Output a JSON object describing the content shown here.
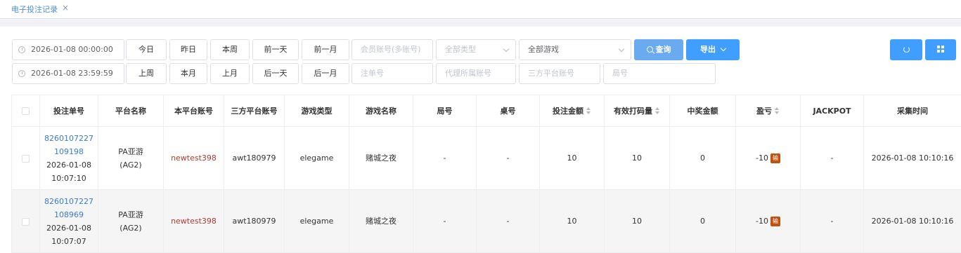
{
  "tab": {
    "label": "电子投注记录",
    "close": "×"
  },
  "filters": {
    "start_time": "2026-01-08 00:00:00",
    "end_time": "2026-01-08 23:59:59",
    "quick_row1": [
      "今日",
      "昨日",
      "本周",
      "前一天",
      "前一月"
    ],
    "quick_row2": [
      "上周",
      "本月",
      "上月",
      "后一天",
      "后一月"
    ],
    "member_placeholder": "会员账号(多账号)",
    "type_placeholder": "全部类型",
    "game_value": "全部游戏",
    "bet_no_placeholder": "注单号",
    "agent_placeholder": "代理所属账号",
    "third_account_placeholder": "三方平台账号",
    "round_placeholder": "局号",
    "query_label": "查询",
    "export_label": "导出"
  },
  "table": {
    "headers": [
      "投注单号",
      "平台名称",
      "本平台账号",
      "三方平台账号",
      "游戏类型",
      "游戏名称",
      "局号",
      "桌号",
      "投注金额",
      "有效打码量",
      "中奖金额",
      "盈亏",
      "JACKPOT",
      "采集时间"
    ],
    "rows": [
      {
        "bet_no_1": "8260107227",
        "bet_no_2": "109198",
        "bet_date": "2026-01-08",
        "bet_time": "10:07:10",
        "platform_1": "PA亚游",
        "platform_2": "(AG2)",
        "account": "newtest398",
        "third_account": "awt180979",
        "game_type": "elegame",
        "game_name": "赌城之夜",
        "round": "-",
        "table_no": "-",
        "bet_amount": "10",
        "valid_bet": "10",
        "win_amount": "0",
        "profit": "-10",
        "profit_badge": "输",
        "jackpot": "-",
        "collect_time": "2026-01-08 10:10:16"
      },
      {
        "bet_no_1": "8260107227",
        "bet_no_2": "108969",
        "bet_date": "2026-01-08",
        "bet_time": "10:07:07",
        "platform_1": "PA亚游",
        "platform_2": "(AG2)",
        "account": "newtest398",
        "third_account": "awt180979",
        "game_type": "elegame",
        "game_name": "赌城之夜",
        "round": "-",
        "table_no": "-",
        "bet_amount": "10",
        "valid_bet": "10",
        "win_amount": "0",
        "profit": "-10",
        "profit_badge": "输",
        "jackpot": "-",
        "collect_time": "2026-01-08 10:10:16"
      }
    ]
  }
}
